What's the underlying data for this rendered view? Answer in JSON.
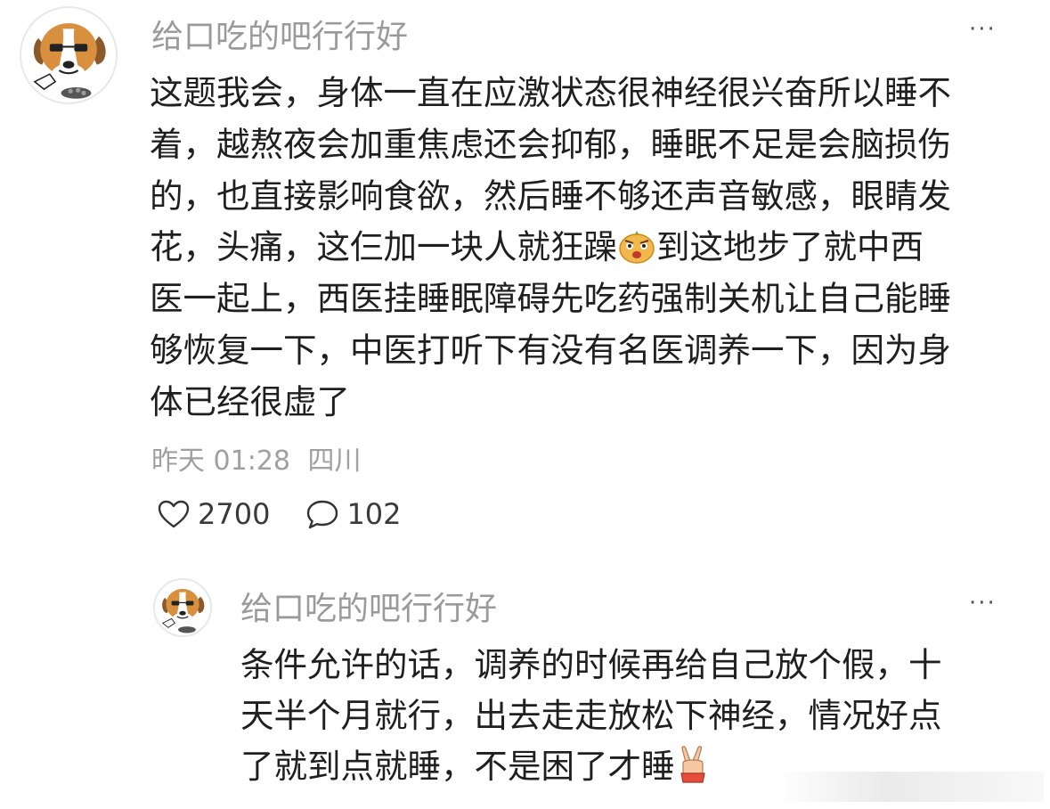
{
  "comment": {
    "username": "给口吃的吧行行好",
    "more_label": "···",
    "lines": [
      "这题我会，身体一直在应激状态很神经很兴奋所以睡不",
      "着，越熬夜会加重焦虑还会抑郁，睡眠不足是会脑损伤",
      "的，也直接影响食欲，然后睡不够还声音敏感，眼睛发",
      "花，头痛，这仨加一块人就狂躁",
      "到这地步了就中西",
      "医一起上，西医挂睡眠障碍先吃药强制关机让自己能睡",
      "够恢复一下，中医打听下有没有名医调养一下，因为身",
      "体已经很虚了"
    ],
    "timestamp": "昨天 01:28",
    "location": "四川",
    "likes": "2700",
    "replies": "102",
    "inline_emoji": "mad-face-emoji"
  },
  "reply": {
    "username": "给口吃的吧行行好",
    "more_label": "···",
    "lines": [
      "条件允许的话，调养的时候再给自己放个假，十",
      "天半个月就行，出去走走放松下神经，情况好点",
      "了就到点就睡，不是困了才睡"
    ],
    "inline_emoji": "victory-hand-emoji"
  },
  "icons": {
    "avatar": "beagle-dog-avatar",
    "like": "heart-outline-icon",
    "reply": "speech-bubble-icon"
  }
}
